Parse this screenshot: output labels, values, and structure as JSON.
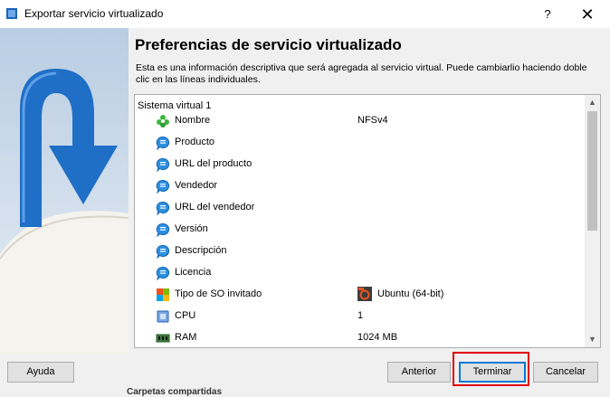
{
  "window": {
    "title": "Exportar servicio virtualizado",
    "help_label": "?",
    "close_label": "✕"
  },
  "page": {
    "heading": "Preferencias de servicio virtualizado",
    "description": "Esta es una información descriptiva que será agregada al servicio virtual. Puede cambiarlio haciendo doble clic en las líneas individuales."
  },
  "tree": {
    "root": "Sistema virtual 1",
    "rows": [
      {
        "label": "Nombre",
        "value": "NFSv4",
        "icon": "name-icon"
      },
      {
        "label": "Producto",
        "value": "",
        "icon": "comment-icon"
      },
      {
        "label": "URL del producto",
        "value": "",
        "icon": "comment-icon"
      },
      {
        "label": "Vendedor",
        "value": "",
        "icon": "comment-icon"
      },
      {
        "label": "URL del vendedor",
        "value": "",
        "icon": "comment-icon"
      },
      {
        "label": "Versión",
        "value": "",
        "icon": "comment-icon"
      },
      {
        "label": "Descripción",
        "value": "",
        "icon": "comment-icon"
      },
      {
        "label": "Licencia",
        "value": "",
        "icon": "comment-icon"
      },
      {
        "label": "Tipo de SO invitado",
        "value": "Ubuntu (64-bit)",
        "icon": "os-type-icon"
      },
      {
        "label": "CPU",
        "value": "1",
        "icon": "cpu-icon"
      },
      {
        "label": "RAM",
        "value": "1024 MB",
        "icon": "ram-icon"
      }
    ]
  },
  "buttons": {
    "help": "Ayuda",
    "back": "Anterior",
    "finish": "Terminar",
    "cancel": "Cancelar"
  },
  "footer_partial": "Carpetas compartidas"
}
